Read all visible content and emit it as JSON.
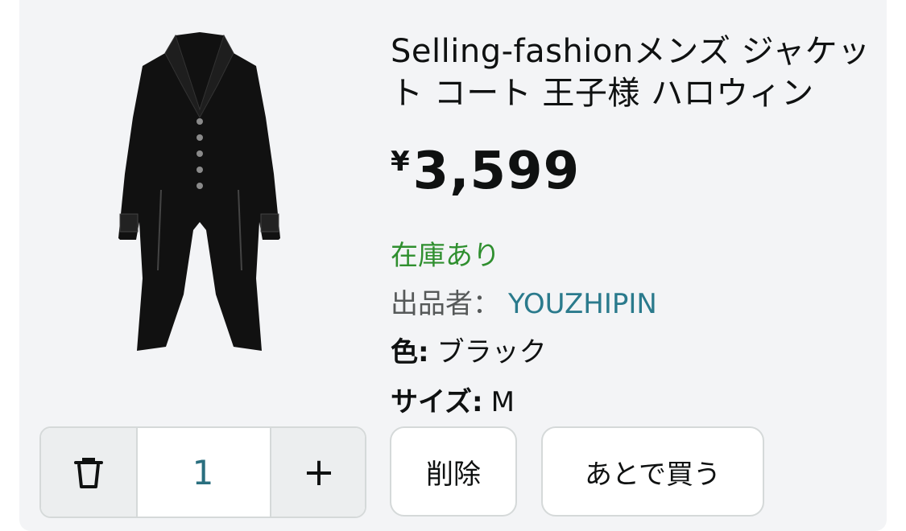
{
  "product": {
    "title": "Selling-fashionメンズ ジャケット コート 王子様 ハロウィン",
    "price_currency": "¥",
    "price_amount": "3,599",
    "stock_status": "在庫あり",
    "seller_label": "出品者：",
    "seller_name": "YOUZHIPIN",
    "color_label": "色:",
    "color_value": "ブラック",
    "size_label": "サイズ:",
    "size_value": "M",
    "image_icon": "tailcoat-product-image"
  },
  "quantity": {
    "value": "1",
    "trash_icon": "trash-icon",
    "plus_label": "+"
  },
  "actions": {
    "delete_label": "削除",
    "save_later_label": "あとで買う"
  },
  "colors": {
    "in_stock": "#2f8f2f",
    "seller_link": "#2a7a8c",
    "card_bg": "#f3f4f6"
  }
}
